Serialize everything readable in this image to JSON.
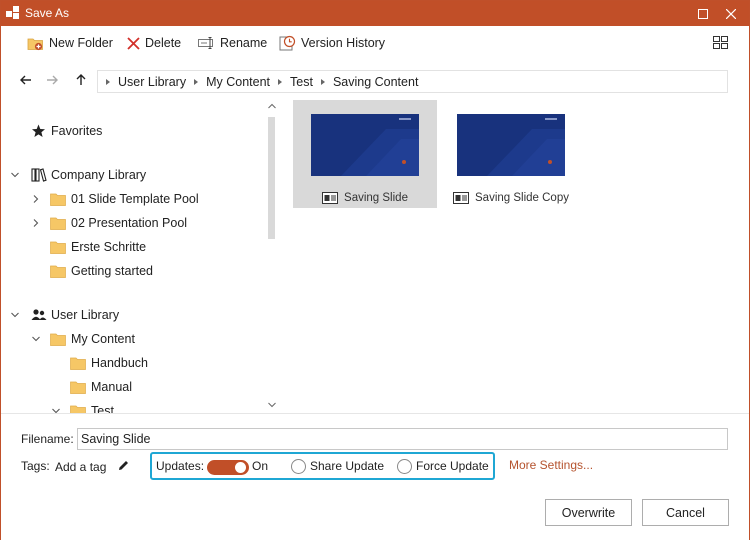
{
  "window": {
    "title": "Save As",
    "accent_color": "#c14f28",
    "highlight_color": "#1fa7d4"
  },
  "toolbar": {
    "new_folder_label": "New Folder",
    "delete_label": "Delete",
    "rename_label": "Rename",
    "version_history_label": "Version History"
  },
  "breadcrumb": [
    "User Library",
    "My Content",
    "Test",
    "Saving Content"
  ],
  "tree": {
    "favorites": "Favorites",
    "company_library": "Company Library",
    "company_items": [
      "01 Slide Template Pool",
      "02 Presentation Pool",
      "Erste Schritte",
      "Getting started"
    ],
    "user_library": "User Library",
    "my_content": "My Content",
    "my_content_items": [
      "Handbuch",
      "Manual",
      "Test"
    ]
  },
  "files": [
    {
      "name": "Saving Slide",
      "thumb_brand": "empower"
    },
    {
      "name": "Saving Slide Copy",
      "thumb_brand": "empower"
    }
  ],
  "footer": {
    "filename_label": "Filename:",
    "filename_value": "Saving Slide",
    "tags_label": "Tags:",
    "add_tag": "Add a tag",
    "updates_label": "Updates:",
    "toggle_state": "On",
    "share_update": "Share Update",
    "force_update": "Force Update",
    "more_settings": "More Settings...",
    "overwrite_label": "Overwrite",
    "cancel_label": "Cancel"
  }
}
